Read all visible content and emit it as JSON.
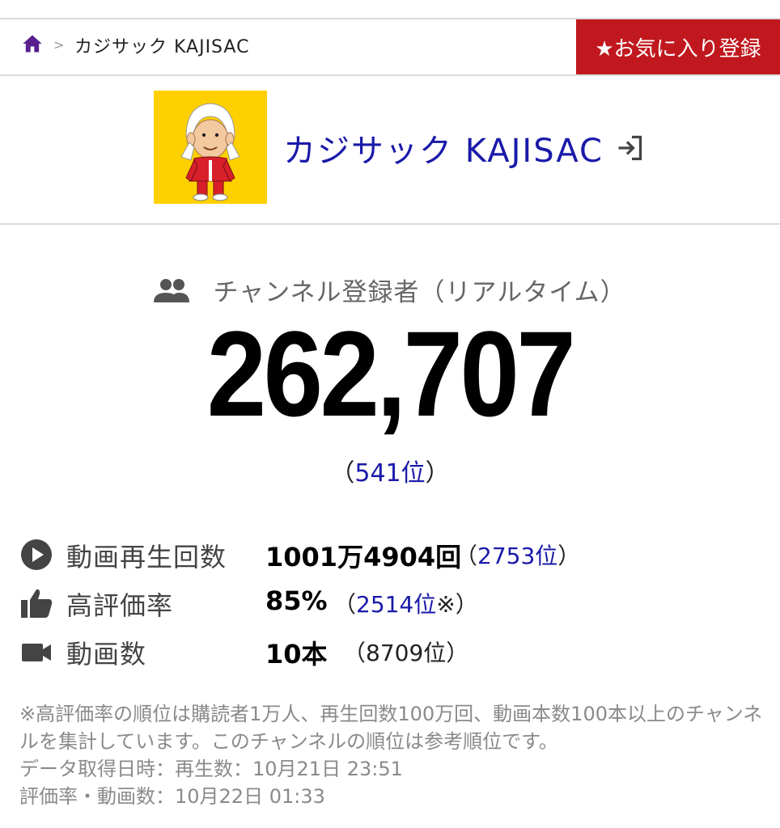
{
  "breadcrumb": {
    "separator": ">",
    "current": "カジサック KAJISAC"
  },
  "favorite_button": {
    "label": "★お気に入り登録"
  },
  "channel": {
    "name": "カジサック KAJISAC"
  },
  "subscribers": {
    "label": "チャンネル登録者（リアルタイム）",
    "count": "262,707",
    "rank_open": "（",
    "rank": "541位",
    "rank_close": "）"
  },
  "stats": [
    {
      "icon": "play-circle-icon",
      "label": "動画再生回数",
      "value": "1001万4904回",
      "rank_open": "（",
      "rank": "2753位",
      "rank_close": "）"
    },
    {
      "icon": "thumbs-up-icon",
      "label": "高評価率",
      "value": "85%",
      "rank_open": "（",
      "rank": "2514位",
      "rank_close": "※）"
    },
    {
      "icon": "video-camera-icon",
      "label": "動画数",
      "value": "10本",
      "rank_text": "（8709位）"
    }
  ],
  "notes": [
    "※高評価率の順位は購読者1万人、再生回数100万回、動画本数100本以上のチャンネルを集計しています。このチャンネルの順位は参考順位です。",
    "データ取得日時：再生数：10月21日 23:51",
    "評価率・動画数：10月22日 01:33"
  ],
  "colors": {
    "accent": "#c0181e",
    "link": "#1a1aaa",
    "home": "#5a1f8f",
    "thumbnail_bg": "#ffd000"
  }
}
